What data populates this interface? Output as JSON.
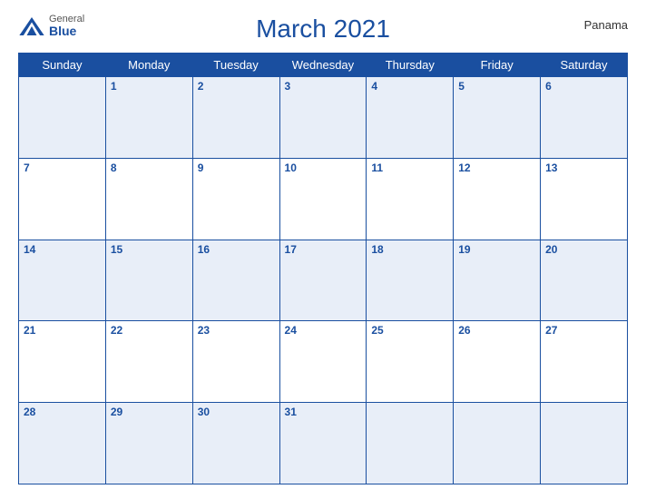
{
  "header": {
    "logo_general": "General",
    "logo_blue": "Blue",
    "title": "March 2021",
    "country": "Panama"
  },
  "days_of_week": [
    "Sunday",
    "Monday",
    "Tuesday",
    "Wednesday",
    "Thursday",
    "Friday",
    "Saturday"
  ],
  "weeks": [
    [
      null,
      1,
      2,
      3,
      4,
      5,
      6
    ],
    [
      7,
      8,
      9,
      10,
      11,
      12,
      13
    ],
    [
      14,
      15,
      16,
      17,
      18,
      19,
      20
    ],
    [
      21,
      22,
      23,
      24,
      25,
      26,
      27
    ],
    [
      28,
      29,
      30,
      31,
      null,
      null,
      null
    ]
  ]
}
